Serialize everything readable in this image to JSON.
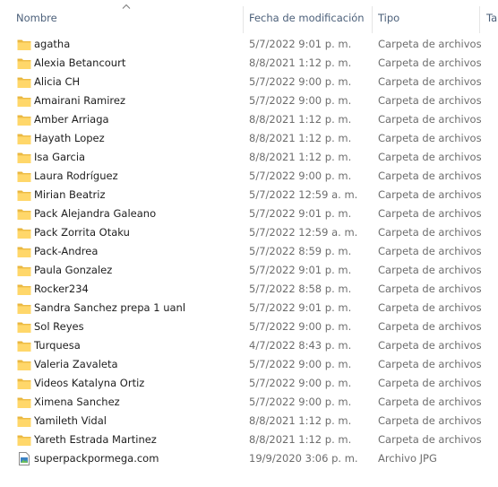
{
  "columns": {
    "name": "Nombre",
    "date": "Fecha de modificación",
    "type": "Tipo",
    "size": "Tam"
  },
  "files": [
    {
      "name": "agatha",
      "date": "5/7/2022 9:01 p. m.",
      "type": "Carpeta de archivos",
      "icon": "folder-icon"
    },
    {
      "name": "Alexia Betancourt",
      "date": "8/8/2021 1:12 p. m.",
      "type": "Carpeta de archivos",
      "icon": "folder-icon"
    },
    {
      "name": "Alicia CH",
      "date": "5/7/2022 9:00 p. m.",
      "type": "Carpeta de archivos",
      "icon": "folder-icon"
    },
    {
      "name": "Amairani Ramirez",
      "date": "5/7/2022 9:00 p. m.",
      "type": "Carpeta de archivos",
      "icon": "folder-icon"
    },
    {
      "name": "Amber Arriaga",
      "date": "8/8/2021 1:12 p. m.",
      "type": "Carpeta de archivos",
      "icon": "folder-icon"
    },
    {
      "name": "Hayath Lopez",
      "date": "8/8/2021 1:12 p. m.",
      "type": "Carpeta de archivos",
      "icon": "folder-icon"
    },
    {
      "name": "Isa Garcia",
      "date": "8/8/2021 1:12 p. m.",
      "type": "Carpeta de archivos",
      "icon": "folder-icon"
    },
    {
      "name": "Laura Rodríguez",
      "date": "5/7/2022 9:00 p. m.",
      "type": "Carpeta de archivos",
      "icon": "folder-icon"
    },
    {
      "name": "Mirian Beatriz",
      "date": "5/7/2022 12:59 a. m.",
      "type": "Carpeta de archivos",
      "icon": "folder-icon"
    },
    {
      "name": "Pack Alejandra Galeano",
      "date": "5/7/2022 9:01 p. m.",
      "type": "Carpeta de archivos",
      "icon": "folder-icon"
    },
    {
      "name": "Pack Zorrita Otaku",
      "date": "5/7/2022 12:59 a. m.",
      "type": "Carpeta de archivos",
      "icon": "folder-icon"
    },
    {
      "name": "Pack-Andrea",
      "date": "5/7/2022 8:59 p. m.",
      "type": "Carpeta de archivos",
      "icon": "folder-icon"
    },
    {
      "name": "Paula Gonzalez",
      "date": "5/7/2022 9:01 p. m.",
      "type": "Carpeta de archivos",
      "icon": "folder-icon"
    },
    {
      "name": "Rocker234",
      "date": "5/7/2022 8:58 p. m.",
      "type": "Carpeta de archivos",
      "icon": "folder-icon"
    },
    {
      "name": "Sandra Sanchez prepa 1 uanl",
      "date": "5/7/2022 9:01 p. m.",
      "type": "Carpeta de archivos",
      "icon": "folder-icon"
    },
    {
      "name": "Sol Reyes",
      "date": "5/7/2022 9:00 p. m.",
      "type": "Carpeta de archivos",
      "icon": "folder-icon"
    },
    {
      "name": "Turquesa",
      "date": "4/7/2022 8:43 p. m.",
      "type": "Carpeta de archivos",
      "icon": "folder-icon"
    },
    {
      "name": "Valeria Zavaleta",
      "date": "5/7/2022 9:00 p. m.",
      "type": "Carpeta de archivos",
      "icon": "folder-icon"
    },
    {
      "name": "Videos Katalyna Ortiz",
      "date": "5/7/2022 9:00 p. m.",
      "type": "Carpeta de archivos",
      "icon": "folder-icon"
    },
    {
      "name": "Ximena Sanchez",
      "date": "5/7/2022 9:00 p. m.",
      "type": "Carpeta de archivos",
      "icon": "folder-icon"
    },
    {
      "name": "Yamileth Vidal",
      "date": "8/8/2021 1:12 p. m.",
      "type": "Carpeta de archivos",
      "icon": "folder-icon"
    },
    {
      "name": "Yareth Estrada Martinez",
      "date": "8/8/2021 1:12 p. m.",
      "type": "Carpeta de archivos",
      "icon": "folder-icon"
    },
    {
      "name": "superpackpormega.com",
      "date": "19/9/2020 3:06 p. m.",
      "type": "Archivo JPG",
      "icon": "image-file-icon"
    }
  ],
  "colors": {
    "header_text": "#4c607a",
    "folder_fill": "#ffd76a",
    "folder_tab": "#e8b53c",
    "secondary_text": "#6d6d6d"
  }
}
